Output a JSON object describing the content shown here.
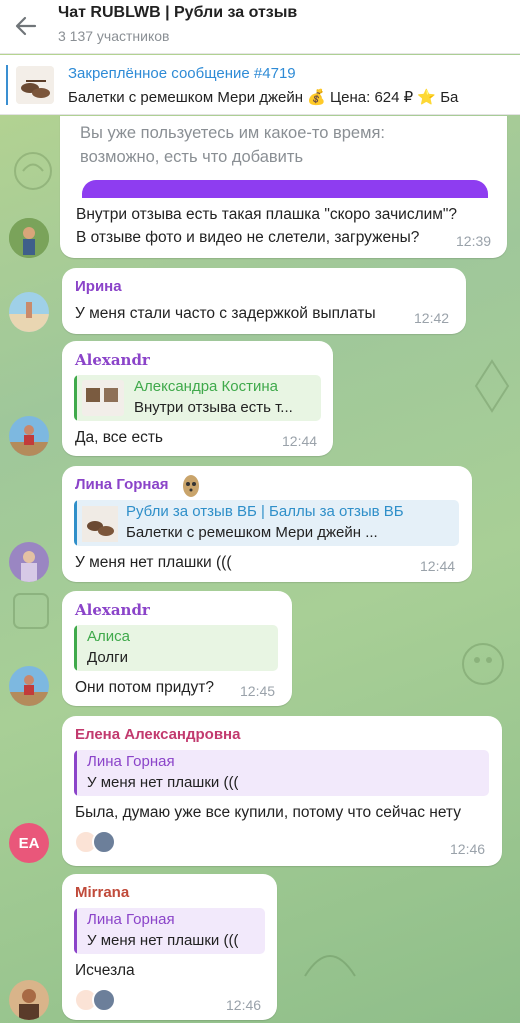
{
  "header": {
    "title": "Чат RUBLWB | Рубли за отзыв",
    "subtitle": "3 137 участников"
  },
  "pinned": {
    "title": "Закреплённое сообщение #4719",
    "text": "Балетки с ремешком Мери джейн   💰 Цена: 624 ₽   ⭐ Ба"
  },
  "colors": {
    "accent": "#2e8bd6",
    "purple_button": "#8e3df0",
    "name_irina": "#8b44c9",
    "name_alexandr": "#8b44c9",
    "name_lina": "#8b44c9",
    "name_elena": "#c23a6e",
    "name_mirrana": "#c04a3a",
    "reply_green": "#3fa94b",
    "reply_blue": "#2f8fc9",
    "reply_purple": "#8b44c9"
  },
  "messages": [
    {
      "id": "m1",
      "quoted_text_line1": "Вы уже пользуетесь им какое-то время:",
      "quoted_text_line2": "возможно, есть что добавить",
      "text_line1": "Внутри отзыва есть такая плашка \"скоро зачислим\"?",
      "text_line2": "В отзыве фото и видео не слетели, загружены?",
      "time": "12:39"
    },
    {
      "id": "m2",
      "sender": "Ирина",
      "text": "У меня стали часто с задержкой выплаты",
      "time": "12:42"
    },
    {
      "id": "m3",
      "sender": "Alexandr",
      "reply_name": "Александра Костина",
      "reply_text": "Внутри отзыва есть т...",
      "text": "Да, все есть",
      "time": "12:44"
    },
    {
      "id": "m4",
      "sender": "Лина Горная",
      "reply_name": "Рубли за отзыв ВБ | Баллы за отзыв ВБ",
      "reply_text": "Балетки с ремешком Мери джейн     ...",
      "text": "У меня нет плашки (((",
      "time": "12:44"
    },
    {
      "id": "m5",
      "sender": "Alexandr",
      "reply_name": "Алиса",
      "reply_text": "Долги",
      "text": "Они потом придут?",
      "time": "12:45"
    },
    {
      "id": "m6",
      "sender": "Елена Александровна",
      "avatar_initials": "ЕА",
      "reply_name": "Лина Горная",
      "reply_text": "У меня нет плашки (((",
      "text": "Была, думаю уже все купили, потому что сейчас нету",
      "time": "12:46"
    },
    {
      "id": "m7",
      "sender": "Mirrana",
      "reply_name": "Лина Горная",
      "reply_text": "У меня нет плашки (((",
      "text": "Исчезла",
      "time": "12:46"
    }
  ],
  "icons": {
    "back": "arrow-left-icon",
    "money_bag": "💰",
    "star": "⭐",
    "reaction": "heart-hands-icon"
  }
}
